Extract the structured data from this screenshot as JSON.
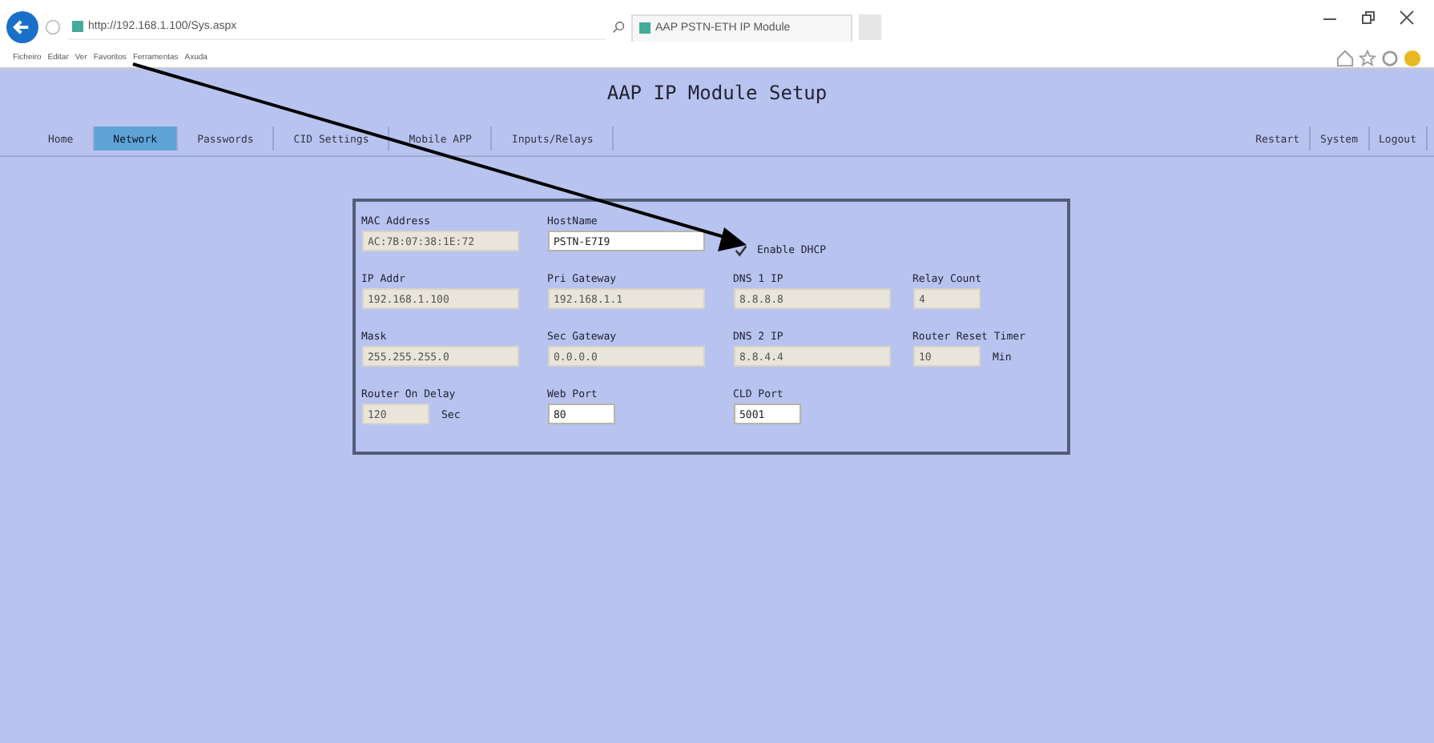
{
  "browser": {
    "address": "http://192.168.1.100/Sys.aspx",
    "tab_title": "AAP PSTN-ETH IP Module",
    "menu": [
      "Ficheiro",
      "Editar",
      "Ver",
      "Favoritos",
      "Ferramentas",
      "Axuda"
    ]
  },
  "title": "AAP IP Module Setup",
  "tabs": [
    {
      "label": "Home",
      "selected": false
    },
    {
      "label": "Network",
      "selected": true
    },
    {
      "label": "Passwords",
      "selected": false
    },
    {
      "label": "CID Settings",
      "selected": false
    },
    {
      "label": "Mobile APP",
      "selected": false
    },
    {
      "label": "Inputs/Relays",
      "selected": false
    }
  ],
  "right_tabs": [
    {
      "label": "Restart",
      "selected": false
    },
    {
      "label": "System",
      "selected": false
    },
    {
      "label": "Logout",
      "selected": false
    }
  ],
  "rows": [
    [
      {
        "kind": "wide",
        "label": "MAC Address",
        "value": "AC:7B:07:38:1E:72",
        "disabled": true
      },
      {
        "kind": "wide",
        "label": "HostName",
        "value": "PSTN-E7I9",
        "disabled": false
      },
      {
        "kind": "checkbox",
        "label": "Enable DHCP",
        "checked": true
      }
    ],
    [
      {
        "kind": "wide",
        "label": "IP Addr",
        "value": "192.168.1.100",
        "disabled": true
      },
      {
        "kind": "wide",
        "label": "Pri Gateway",
        "value": "192.168.1.1",
        "disabled": true
      },
      {
        "kind": "wide",
        "label": "DNS 1 IP",
        "value": "8.8.8.8",
        "disabled": true
      },
      {
        "kind": "short",
        "label": "Relay Count",
        "value": "4",
        "disabled": true
      }
    ],
    [
      {
        "kind": "wide",
        "label": "Mask",
        "value": "255.255.255.0",
        "disabled": true
      },
      {
        "kind": "wide",
        "label": "Sec Gateway",
        "value": "0.0.0.0",
        "disabled": true
      },
      {
        "kind": "wide",
        "label": "DNS 2 IP",
        "value": "8.8.4.4",
        "disabled": true
      },
      {
        "kind": "short",
        "label": "Router Reset Timer",
        "value": "10",
        "disabled": true,
        "unit": "Min"
      }
    ],
    [
      {
        "kind": "short",
        "label": "Router On Delay",
        "value": "120",
        "disabled": true,
        "unit": "Sec"
      },
      {
        "kind": "short",
        "label": "Web Port",
        "value": "80",
        "disabled": false
      },
      {
        "kind": "short",
        "label": "CLD Port",
        "value": "5001",
        "disabled": false
      }
    ]
  ]
}
